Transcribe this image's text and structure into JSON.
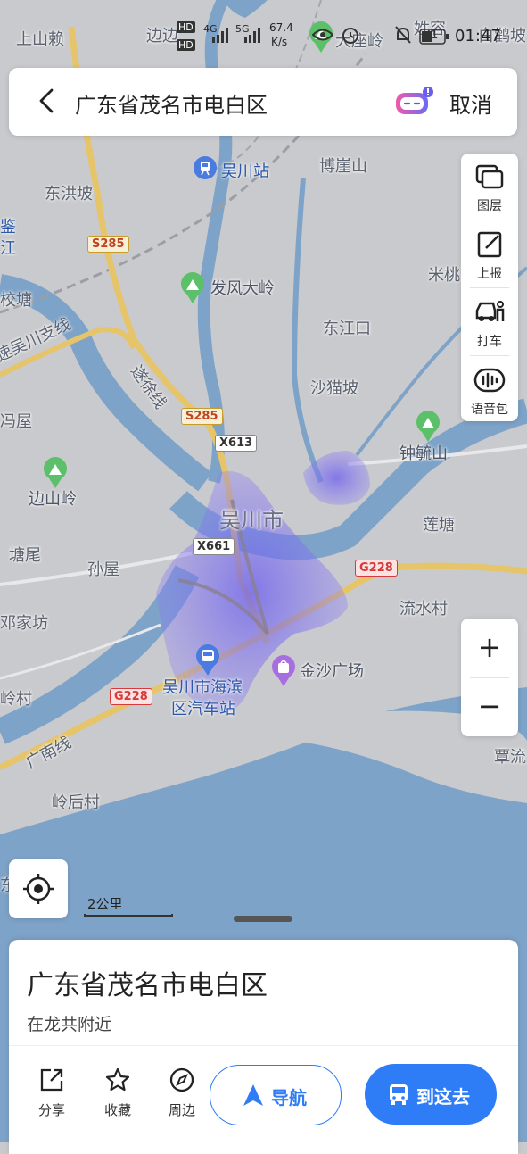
{
  "status_bar": {
    "hd1": "HD",
    "hd2": "HD",
    "net4g": "4G",
    "net5g": "5G",
    "speed": "67.4\nK/s",
    "speed_val": "67.4",
    "speed_unit": "K/s",
    "battery": "41",
    "time": "01:47"
  },
  "search": {
    "query": "广东省茂名市电白区",
    "cancel_label": "取消"
  },
  "tools": [
    {
      "label": "图层",
      "icon": "layers-icon"
    },
    {
      "label": "上报",
      "icon": "report-edit-icon"
    },
    {
      "label": "打车",
      "icon": "taxi-icon"
    },
    {
      "label": "语音包",
      "icon": "voice-pack-icon"
    }
  ],
  "map": {
    "labels": {
      "shangshanlai": "上山赖",
      "bianbian": "边边",
      "dazuoling": "大座岭",
      "xingrong": "姓容",
      "baiji": "白鹳坡",
      "wuchuan_station": "吴川站",
      "bochashan": "博崖山",
      "donghongpo": "东洪坡",
      "jian": "鉴",
      "jiang": "江",
      "mi": "米桃",
      "fafengdaling": "发风大岭",
      "xiaotang": "校塘",
      "dongjiangkou": "东江口",
      "wuchuan_branch": "速吴川支线",
      "suixu": "遂徐线",
      "shamaopo": "沙猫坡",
      "fengwu": "冯屋",
      "zhongyushan": "钟毓山",
      "bianshanling": "边山岭",
      "wuchuan_city": "吴川市",
      "liantang": "莲塘",
      "tangwei": "塘尾",
      "sunwu": "孙屋",
      "dengjiafang": "邓家坊",
      "liushuicun": "流水村",
      "jinsha": "金沙广场",
      "haibin_bus_1": "吴川市海滨",
      "haibin_bus_2": "区汽车站",
      "lingcun": "岭村",
      "guangnan": "广南线",
      "linghoucun": "岭后村",
      "tanliu": "覃流",
      "dong": "东"
    },
    "shields": {
      "s285_top": "S285",
      "s285_mid": "S285",
      "x613": "X613",
      "x661": "X661",
      "g228_right": "G228",
      "g228_left": "G228"
    },
    "scale_label": "2公里"
  },
  "zoom": {
    "in_label": "+",
    "out_label": "−"
  },
  "place_card": {
    "title": "广东省茂名市电白区",
    "subtitle": "在龙共附近",
    "actions": [
      {
        "label": "分享",
        "icon": "share-icon"
      },
      {
        "label": "收藏",
        "icon": "star-icon"
      },
      {
        "label": "周边",
        "icon": "compass-icon"
      }
    ],
    "nav_label": "导航",
    "go_label": "到这去"
  },
  "colors": {
    "accent": "#2e7cf6",
    "water": "#7ea3c8",
    "land": "#c9cacd",
    "heat": "#7d6cf0"
  }
}
